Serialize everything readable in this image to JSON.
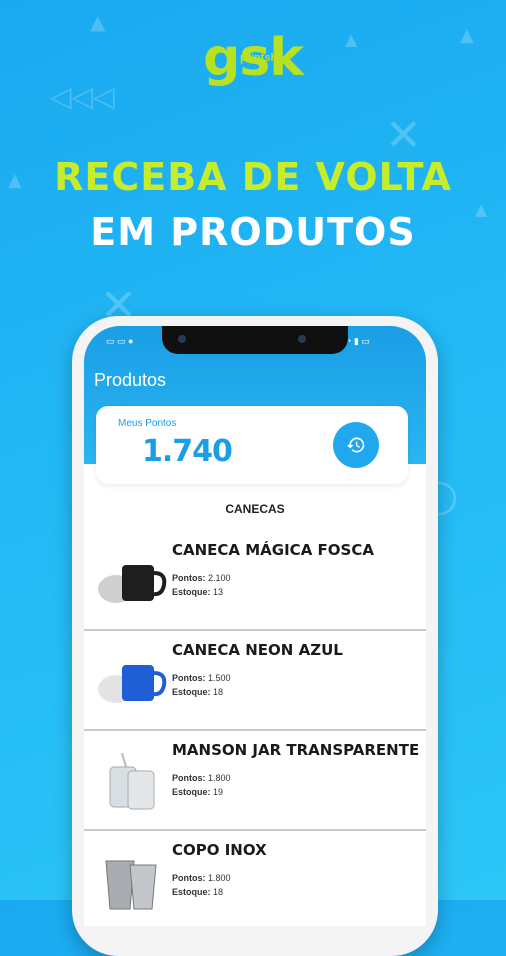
{
  "brand": {
    "logo_text": "gsk",
    "logo_sub": "printshop"
  },
  "headline": {
    "line1": "RECEBA DE VOLTA",
    "line2": "EM PRODUTOS"
  },
  "app": {
    "title": "Produtos",
    "points_label": "Meus Pontos",
    "points_value": "1.740",
    "category": "CANECAS",
    "points_prefix": "Pontos:",
    "stock_prefix": "Estoque:"
  },
  "products": [
    {
      "name": "CANECA MÁGICA FOSCA",
      "points": "2.100",
      "stock": "13"
    },
    {
      "name": "CANECA NEON AZUL",
      "points": "1.500",
      "stock": "18"
    },
    {
      "name": "MANSON JAR TRANSPARENTE",
      "points": "1.800",
      "stock": "19"
    },
    {
      "name": "COPO INOX",
      "points": "1.800",
      "stock": "18"
    }
  ],
  "icons": [
    "history-icon",
    "mug-icon",
    "jar-icon",
    "tumbler-icon"
  ],
  "colors": {
    "background": "#22b8f5",
    "accent": "#1a9ee5",
    "lime": "#c6ec2b"
  }
}
